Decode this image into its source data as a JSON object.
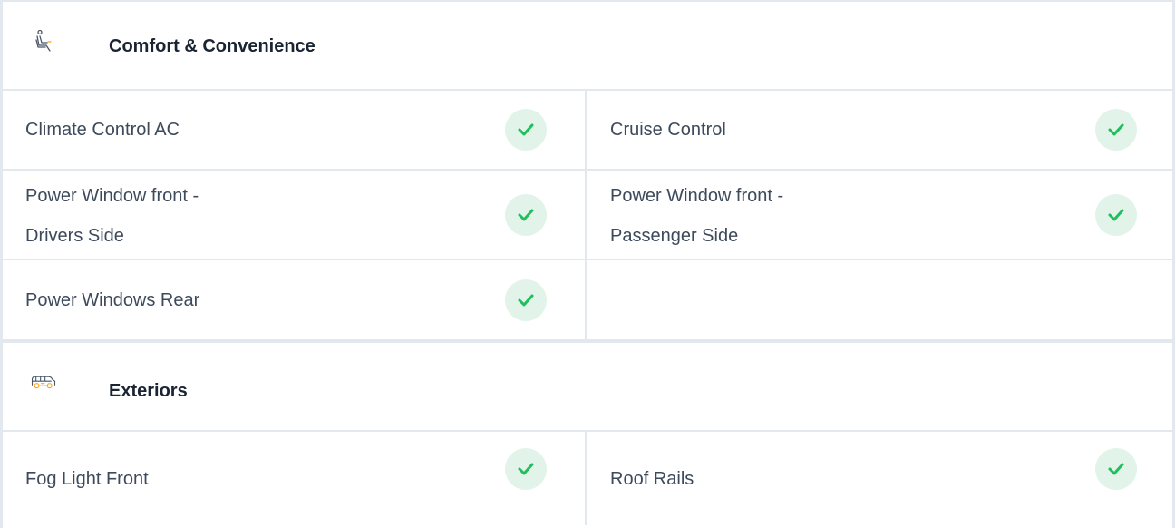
{
  "sections": [
    {
      "icon": "seat-icon",
      "title": "Comfort & Convenience",
      "rows": [
        [
          {
            "label": "Climate Control AC",
            "available": true
          },
          {
            "label": "Cruise Control",
            "available": true
          }
        ],
        [
          {
            "label_lines": [
              "Power Window front -",
              "Drivers Side"
            ],
            "available": true
          },
          {
            "label_lines": [
              "Power Window front -",
              "Passenger Side"
            ],
            "available": true
          }
        ],
        [
          {
            "label": "Power Windows Rear",
            "available": true
          },
          null
        ]
      ]
    },
    {
      "icon": "car-exterior-icon",
      "title": "Exteriors",
      "rows": [
        [
          {
            "label": "Fog Light Front",
            "available": true
          },
          {
            "label": "Roof Rails",
            "available": true
          }
        ]
      ]
    }
  ],
  "colors": {
    "border": "#e3e8ef",
    "check": "#1fbf5c",
    "check_bg": "#e2f4ea",
    "icon_orange": "#f5a623"
  }
}
